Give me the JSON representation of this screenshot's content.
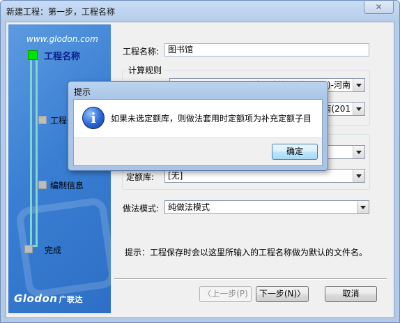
{
  "window": {
    "title": "新建工程：第一步，工程名称",
    "close_glyph": "✕"
  },
  "sidebar": {
    "website": "www.glodon.com",
    "steps": [
      {
        "label": "工程名称",
        "active": true
      },
      {
        "label": "工程信",
        "active": false
      },
      {
        "label": "编制信息",
        "active": false
      },
      {
        "label": "完成",
        "active": false
      }
    ],
    "brand_text": "Glodon",
    "brand_cn": "广联达"
  },
  "form": {
    "project_name_label": "工程名称:",
    "project_name_value": "图书馆",
    "calc_rules_group": "计算规则",
    "rule1_value": "清单计算规则(2013)-河南",
    "rule2_value": "定额计算规则(2013)-河南(201",
    "quota_lib_label": "定额库:",
    "quota_lib_value": "[无]",
    "method_label": "做法模式:",
    "method_value": "纯做法模式",
    "hint": "提示：工程保存时会以这里所输入的工程名称做为默认的文件名。"
  },
  "buttons": {
    "prev": "〈上一步(P)",
    "next": "下一步(N)〉",
    "cancel": "取消"
  },
  "dialog": {
    "title": "提示",
    "icon": "i",
    "message": "如果未选定额库，则做法套用时定额项为补充定额子目",
    "ok": "确定"
  }
}
